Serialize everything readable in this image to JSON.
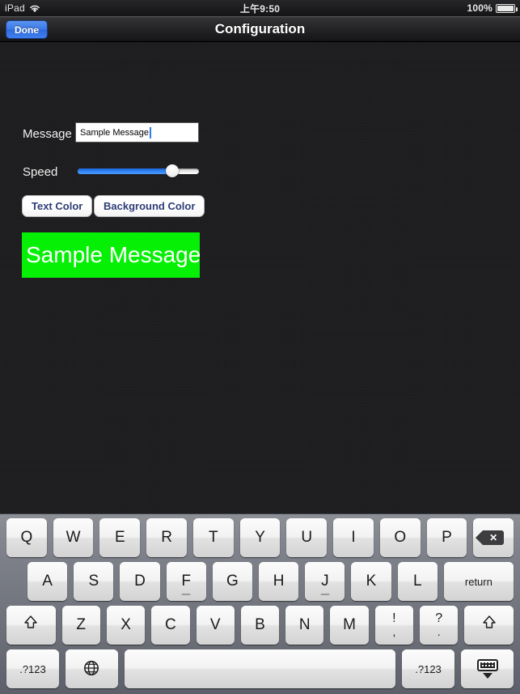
{
  "status_bar": {
    "device": "iPad",
    "wifi_icon": "wifi-icon",
    "time": "上午9:50",
    "battery_percent": "100%",
    "battery_icon": "battery-full-icon"
  },
  "nav_bar": {
    "title": "Configuration",
    "done_label": "Done"
  },
  "form": {
    "message_label": "Message",
    "message_value": "Sample Message",
    "message_placeholder": "",
    "speed_label": "Speed",
    "speed_percent": 78,
    "text_color_label": "Text Color",
    "background_color_label": "Background Color"
  },
  "preview": {
    "text": "Sample Message",
    "text_color": "#ffffff",
    "background_color": "#06f006"
  },
  "keyboard": {
    "row1": [
      {
        "label": "Q",
        "name": "key-q"
      },
      {
        "label": "W",
        "name": "key-w"
      },
      {
        "label": "E",
        "name": "key-e"
      },
      {
        "label": "R",
        "name": "key-r"
      },
      {
        "label": "T",
        "name": "key-t"
      },
      {
        "label": "Y",
        "name": "key-y"
      },
      {
        "label": "U",
        "name": "key-u"
      },
      {
        "label": "I",
        "name": "key-i"
      },
      {
        "label": "O",
        "name": "key-o"
      },
      {
        "label": "P",
        "name": "key-p"
      },
      {
        "label": "",
        "name": "key-backspace",
        "icon": "delete-icon"
      }
    ],
    "row2": [
      {
        "label": "A",
        "name": "key-a"
      },
      {
        "label": "S",
        "name": "key-s"
      },
      {
        "label": "D",
        "name": "key-d"
      },
      {
        "label": "F",
        "name": "key-f"
      },
      {
        "label": "G",
        "name": "key-g"
      },
      {
        "label": "H",
        "name": "key-h"
      },
      {
        "label": "J",
        "name": "key-j"
      },
      {
        "label": "K",
        "name": "key-k"
      },
      {
        "label": "L",
        "name": "key-l"
      },
      {
        "label": "return",
        "name": "key-return"
      }
    ],
    "row3": [
      {
        "label": "",
        "name": "key-shift-left",
        "icon": "shift-icon"
      },
      {
        "label": "Z",
        "name": "key-z"
      },
      {
        "label": "X",
        "name": "key-x"
      },
      {
        "label": "C",
        "name": "key-c"
      },
      {
        "label": "V",
        "name": "key-v"
      },
      {
        "label": "B",
        "name": "key-b"
      },
      {
        "label": "N",
        "name": "key-n"
      },
      {
        "label": "M",
        "name": "key-m"
      },
      {
        "label": "!",
        "sub": ",",
        "name": "key-exclam-comma"
      },
      {
        "label": "?",
        "sub": ".",
        "name": "key-question-period"
      },
      {
        "label": "",
        "name": "key-shift-right",
        "icon": "shift-icon"
      }
    ],
    "row4": [
      {
        "label": ".?123",
        "name": "key-numeric-left"
      },
      {
        "label": "",
        "name": "key-globe",
        "icon": "globe-icon"
      },
      {
        "label": "",
        "name": "key-space"
      },
      {
        "label": ".?123",
        "name": "key-numeric-right"
      },
      {
        "label": "",
        "name": "key-dismiss-keyboard",
        "icon": "keyboard-dismiss-icon"
      }
    ]
  }
}
